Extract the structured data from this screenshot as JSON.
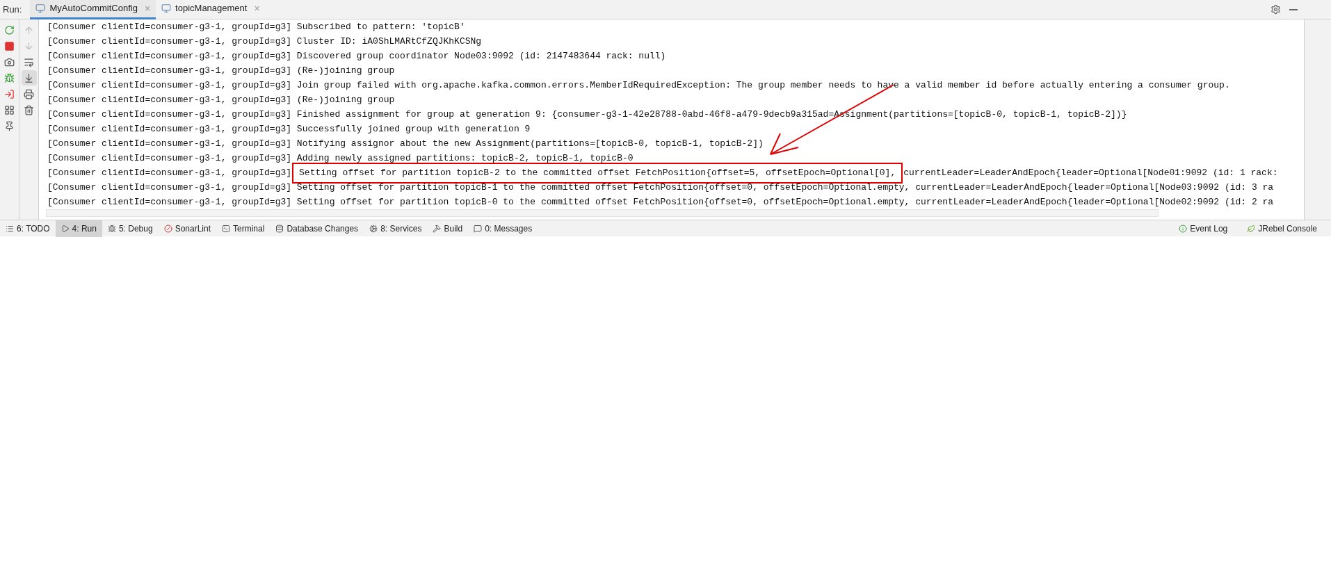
{
  "run_panel": {
    "label": "Run:",
    "tabs": [
      {
        "label": "MyAutoCommitConfig",
        "selected": true,
        "close": "×"
      },
      {
        "label": "topicManagement",
        "selected": false,
        "close": "×"
      }
    ]
  },
  "console": {
    "lines": [
      {
        "kind": "plain",
        "text": "[Consumer clientId=consumer-g3-1, groupId=g3] Subscribed to pattern: 'topicB'"
      },
      {
        "kind": "plain",
        "text": "[Consumer clientId=consumer-g3-1, groupId=g3] Cluster ID: iA0ShLMARtCfZQJKhKCSNg"
      },
      {
        "kind": "plain",
        "text": "[Consumer clientId=consumer-g3-1, groupId=g3] Discovered group coordinator Node03:9092 (id: 2147483644 rack: null)"
      },
      {
        "kind": "plain",
        "text": "[Consumer clientId=consumer-g3-1, groupId=g3] (Re-)joining group"
      },
      {
        "kind": "plain",
        "text": "[Consumer clientId=consumer-g3-1, groupId=g3] Join group failed with org.apache.kafka.common.errors.MemberIdRequiredException: The group member needs to have a valid member id before actually entering a consumer group."
      },
      {
        "kind": "plain",
        "text": "[Consumer clientId=consumer-g3-1, groupId=g3] (Re-)joining group"
      },
      {
        "kind": "plain",
        "text": "[Consumer clientId=consumer-g3-1, groupId=g3] Finished assignment for group at generation 9: {consumer-g3-1-42e28788-0abd-46f8-a479-9decb9a315ad=Assignment(partitions=[topicB-0, topicB-1, topicB-2])}"
      },
      {
        "kind": "plain",
        "text": "[Consumer clientId=consumer-g3-1, groupId=g3] Successfully joined group with generation 9"
      },
      {
        "kind": "plain",
        "text": "[Consumer clientId=consumer-g3-1, groupId=g3] Notifying assignor about the new Assignment(partitions=[topicB-0, topicB-1, topicB-2])"
      },
      {
        "kind": "plain",
        "text": "[Consumer clientId=consumer-g3-1, groupId=g3] Adding newly assigned partitions: topicB-2, topicB-1, topicB-0"
      },
      {
        "kind": "annotated",
        "before": "[Consumer clientId=consumer-g3-1, groupId=g3]",
        "boxed": "Setting offset for partition topicB-2 to the committed offset FetchPosition{offset=5, offsetEpoch=Optional[0],",
        "after": "currentLeader=LeaderAndEpoch{leader=Optional[Node01:9092 (id: 1 rack:"
      },
      {
        "kind": "plain",
        "text": "[Consumer clientId=consumer-g3-1, groupId=g3] Setting offset for partition topicB-1 to the committed offset FetchPosition{offset=0, offsetEpoch=Optional.empty, currentLeader=LeaderAndEpoch{leader=Optional[Node03:9092 (id: 3 ra"
      },
      {
        "kind": "plain",
        "text": "[Consumer clientId=consumer-g3-1, groupId=g3] Setting offset for partition topicB-0 to the committed offset FetchPosition{offset=0, offsetEpoch=Optional.empty, currentLeader=LeaderAndEpoch{leader=Optional[Node02:9092 (id: 2 ra"
      }
    ]
  },
  "bottom_bar": {
    "left": [
      {
        "kind": "list",
        "label": "6: TODO",
        "selected": false
      },
      {
        "kind": "run",
        "label": "4: Run",
        "selected": true
      },
      {
        "kind": "debug",
        "label": "5: Debug",
        "selected": false
      },
      {
        "kind": "sonar",
        "label": "SonarLint",
        "selected": false
      },
      {
        "kind": "terminal",
        "label": "Terminal",
        "selected": false
      },
      {
        "kind": "database",
        "label": "Database Changes",
        "selected": false
      },
      {
        "kind": "services",
        "label": "8: Services",
        "selected": false
      },
      {
        "kind": "build",
        "label": "Build",
        "selected": false
      },
      {
        "kind": "messages",
        "label": "0: Messages",
        "selected": false
      }
    ],
    "right": [
      {
        "kind": "eventlog",
        "label": "Event Log"
      },
      {
        "kind": "jrebel",
        "label": "JRebel Console"
      }
    ]
  }
}
